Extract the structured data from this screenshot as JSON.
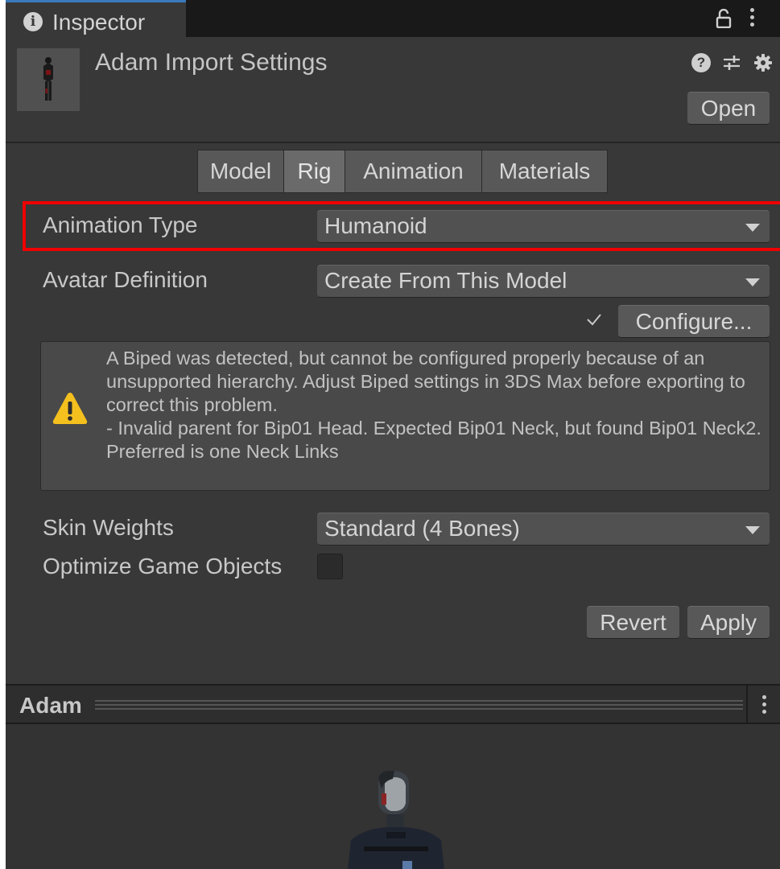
{
  "window": {
    "tab_label": "Inspector"
  },
  "header": {
    "title": "Adam Import Settings",
    "open_label": "Open"
  },
  "toolbar": {
    "tabs": [
      {
        "label": "Model",
        "active": false
      },
      {
        "label": "Rig",
        "active": true
      },
      {
        "label": "Animation",
        "active": false
      },
      {
        "label": "Materials",
        "active": false
      }
    ]
  },
  "rig": {
    "animation_type": {
      "label": "Animation Type",
      "value": "Humanoid"
    },
    "avatar_definition": {
      "label": "Avatar Definition",
      "value": "Create From This Model"
    },
    "configure_label": "Configure...",
    "warning_text": "A Biped was detected, but cannot be configured properly because of an unsupported hierarchy. Adjust Biped settings in 3DS Max before exporting to correct this problem.\n- Invalid parent for Bip01 Head. Expected Bip01 Neck, but found Bip01 Neck2. Preferred is one Neck Links",
    "skin_weights": {
      "label": "Skin Weights",
      "value": "Standard (4 Bones)"
    },
    "optimize_game_objects": {
      "label": "Optimize Game Objects",
      "checked": false
    }
  },
  "actions": {
    "revert_label": "Revert",
    "apply_label": "Apply"
  },
  "preview": {
    "title": "Adam"
  },
  "colors": {
    "accent_tab": "#3a79bb",
    "highlight": "#ee0000",
    "warning": "#f4c01e"
  }
}
